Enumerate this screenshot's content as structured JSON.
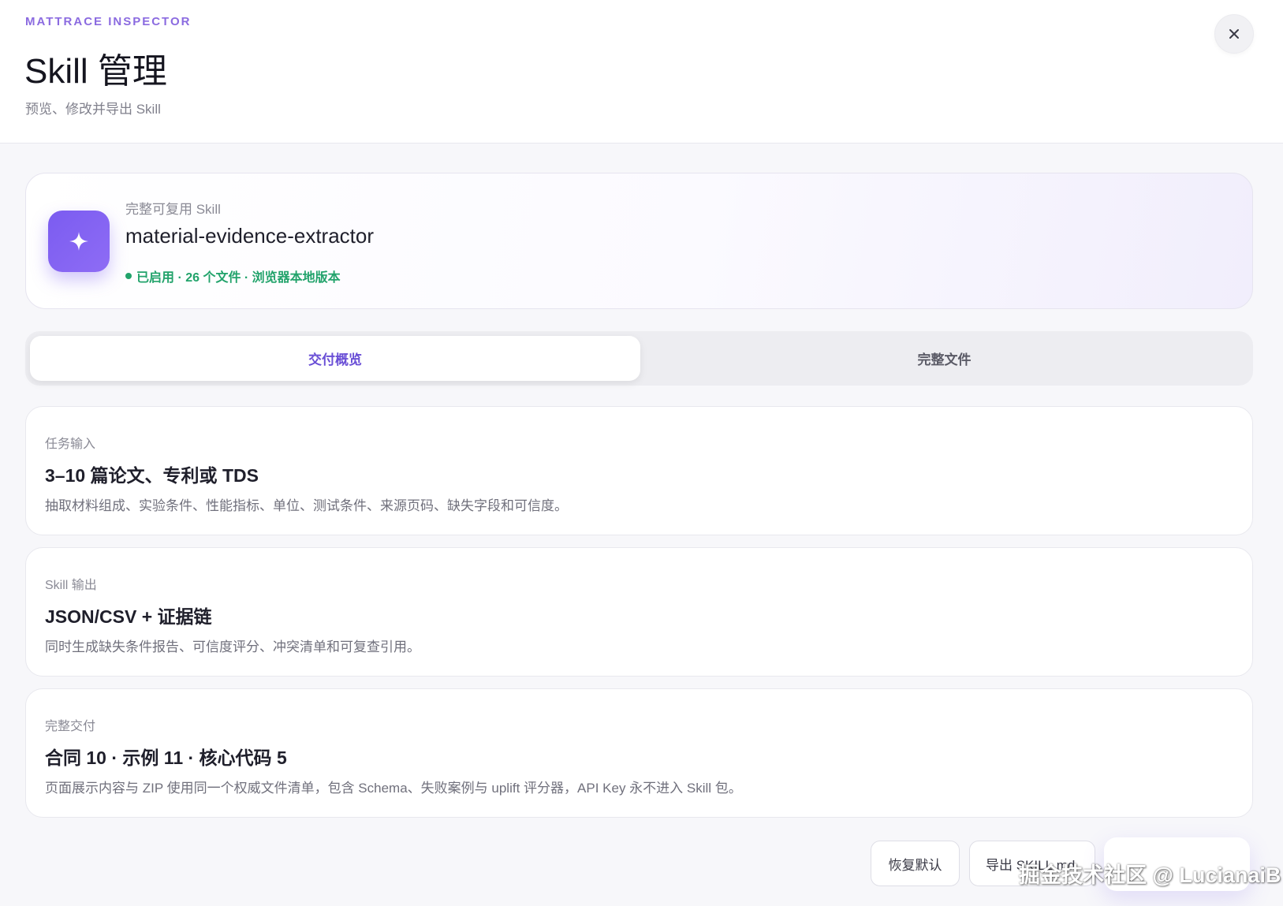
{
  "header": {
    "eyebrow": "MATTRACE INSPECTOR",
    "title": "Skill 管理",
    "subtitle": "预览、修改并导出 Skill",
    "close_icon": "close-icon"
  },
  "skill": {
    "icon": "sparkle-icon",
    "kind_label": "完整可复用 Skill",
    "name": "material-evidence-extractor",
    "status_text": "已启用 · 26 个文件 · 浏览器本地版本",
    "status_color": "#22a36b",
    "accent_color": "#7b5cf0"
  },
  "tabs": [
    {
      "label": "交付概览",
      "active": true
    },
    {
      "label": "完整文件",
      "active": false
    }
  ],
  "cards": [
    {
      "label": "任务输入",
      "value": "3–10 篇论文、专利或 TDS",
      "desc": "抽取材料组成、实验条件、性能指标、单位、测试条件、来源页码、缺失字段和可信度。"
    },
    {
      "label": "Skill 输出",
      "value": "JSON/CSV + 证据链",
      "desc": "同时生成缺失条件报告、可信度评分、冲突清单和可复查引用。"
    },
    {
      "label": "完整交付",
      "value": "合同 10 · 示例 11 · 核心代码 5",
      "desc": "页面展示内容与 ZIP 使用同一个权威文件清单，包含 Schema、失败案例与 uplift 评分器，API Key 永不进入 Skill 包。"
    }
  ],
  "footer": {
    "restore_label": "恢复默认",
    "export_label": "导出 SKILL.md",
    "watermark": "掘金技术社区 @ LucianaiB"
  }
}
